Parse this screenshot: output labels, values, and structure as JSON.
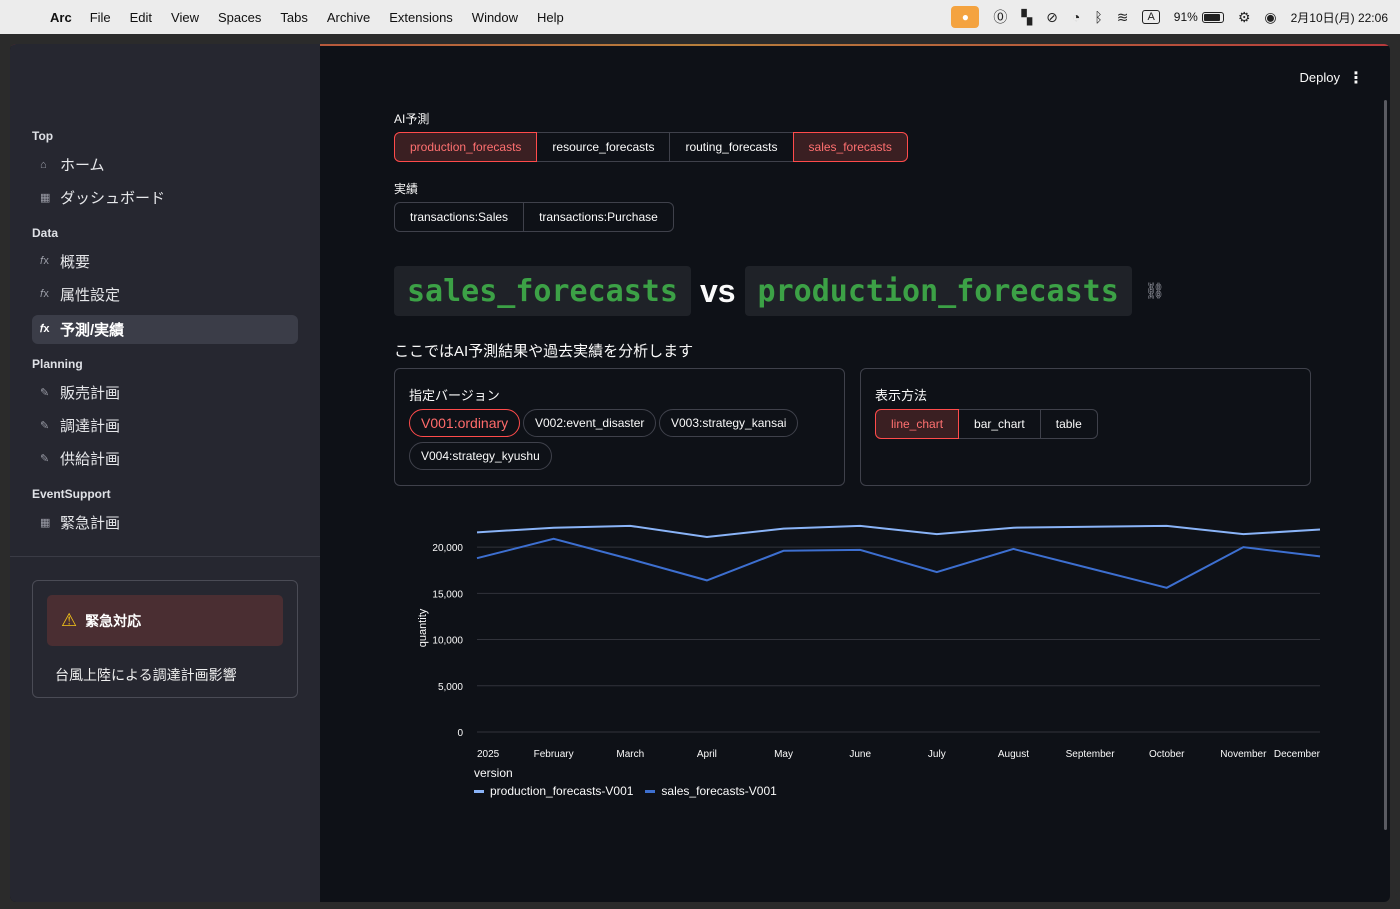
{
  "menubar": {
    "app_name": "Arc",
    "menus": [
      "File",
      "Edit",
      "View",
      "Spaces",
      "Tabs",
      "Archive",
      "Extensions",
      "Window",
      "Help"
    ],
    "battery": "91%",
    "battery_level": 0.91,
    "clock": "2月10日(月) 22:06",
    "input_indicator": "A"
  },
  "sidebar": {
    "sections": [
      {
        "title": "Top",
        "items": [
          {
            "label": "ホーム",
            "icon": "home-icon"
          },
          {
            "label": "ダッシュボード",
            "icon": "grid-icon"
          }
        ]
      },
      {
        "title": "Data",
        "items": [
          {
            "label": "概要",
            "icon": "function-icon"
          },
          {
            "label": "属性設定",
            "icon": "function-icon"
          },
          {
            "label": "予測/実績",
            "icon": "function-icon",
            "active": true
          }
        ]
      },
      {
        "title": "Planning",
        "items": [
          {
            "label": "販売計画",
            "icon": "pencil-icon"
          },
          {
            "label": "調達計画",
            "icon": "pencil-icon"
          },
          {
            "label": "供給計画",
            "icon": "pencil-icon"
          }
        ]
      },
      {
        "title": "EventSupport",
        "items": [
          {
            "label": "緊急計画",
            "icon": "grid-icon"
          }
        ]
      }
    ],
    "alert": {
      "title": "緊急対応",
      "message": "台風上陸による調達計画影響"
    }
  },
  "header": {
    "deploy_label": "Deploy"
  },
  "ai_forecast": {
    "label": "AI予測",
    "options": [
      "production_forecasts",
      "resource_forecasts",
      "routing_forecasts",
      "sales_forecasts"
    ],
    "selected": [
      "production_forecasts",
      "sales_forecasts"
    ]
  },
  "actuals": {
    "label": "実績",
    "options": [
      "transactions:Sales",
      "transactions:Purchase"
    ]
  },
  "title": {
    "left": "sales_forecasts",
    "vs": "vs",
    "right": "production_forecasts"
  },
  "subtitle": "ここではAI予測結果や過去実績を分析します",
  "version_card": {
    "title": "指定バージョン",
    "options": [
      "V001:ordinary",
      "V002:event_disaster",
      "V003:strategy_kansai",
      "V004:strategy_kyushu"
    ],
    "selected": "V001:ordinary"
  },
  "display_card": {
    "title": "表示方法",
    "options": [
      "line_chart",
      "bar_chart",
      "table"
    ],
    "selected": "line_chart"
  },
  "chart_data": {
    "type": "line",
    "x": [
      "2025",
      "February",
      "March",
      "April",
      "May",
      "June",
      "July",
      "August",
      "September",
      "October",
      "November",
      "December"
    ],
    "ylabel": "quantity",
    "xlabel": "",
    "ylim": [
      0,
      22500
    ],
    "yticks": [
      0,
      5000,
      10000,
      15000,
      20000
    ],
    "ytick_labels": [
      "0",
      "5,000",
      "10,000",
      "15,000",
      "20,000"
    ],
    "grid": true,
    "legend_title": "version",
    "series": [
      {
        "name": "production_forecasts-V001",
        "color": "#8ab4f8",
        "values": [
          21600,
          22100,
          22300,
          21100,
          22000,
          22300,
          21400,
          22100,
          22200,
          22300,
          21400,
          21900
        ]
      },
      {
        "name": "sales_forecasts-V001",
        "color": "#3d6fd0",
        "values": [
          18800,
          20900,
          18700,
          16400,
          19600,
          19700,
          17300,
          19800,
          17700,
          15600,
          20000,
          19000
        ]
      }
    ]
  }
}
